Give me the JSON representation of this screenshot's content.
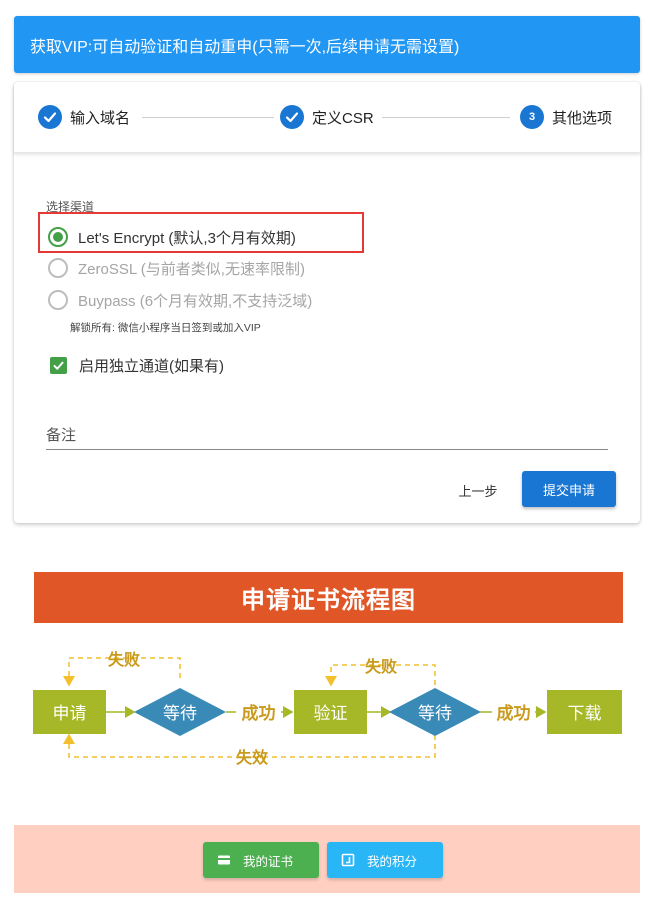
{
  "banner": {
    "text": "获取VIP:可自动验证和自动重申(只需一次,后续申请无需设置)"
  },
  "stepper": {
    "steps": [
      {
        "label": "输入域名",
        "state": "done"
      },
      {
        "label": "定义CSR",
        "state": "done"
      },
      {
        "label": "其他选项",
        "number": "3",
        "state": "active"
      }
    ]
  },
  "form": {
    "channel_label": "选择渠道",
    "channels": [
      {
        "label": "Let's Encrypt (默认,3个月有效期)",
        "selected": true
      },
      {
        "label": "ZeroSSL (与前者类似,无速率限制)",
        "selected": false
      },
      {
        "label": "Buypass (6个月有效期,不支持泛域)",
        "selected": false
      }
    ],
    "unlock_hint": "解锁所有: 微信小程序当日签到或加入VIP",
    "dedicated_channel_label": "启用独立通道(如果有)",
    "dedicated_channel_checked": true,
    "remark_placeholder": "备注",
    "prev_button": "上一步",
    "submit_button": "提交申请"
  },
  "flowchart": {
    "title": "申请证书流程图",
    "nodes": {
      "apply": "申请",
      "wait1": "等待",
      "verify": "验证",
      "wait2": "等待",
      "download": "下载"
    },
    "edges": {
      "success1": "成功",
      "success2": "成功",
      "fail1": "失败",
      "fail2": "失败",
      "expired": "失效"
    },
    "colors": {
      "title_bg": "#e05627",
      "box": "#a6b827",
      "diamond": "#3a8ab8",
      "dashed": "#f2c02c",
      "edge_text": "#c99a1c"
    }
  },
  "footer": {
    "my_certs": "我的证书",
    "my_points": "我的积分",
    "icons": [
      "card-icon",
      "calendar-icon"
    ]
  },
  "colors": {
    "primary": "#1976d2",
    "banner": "#2196f3",
    "success": "#43a047",
    "highlight": "#e53935",
    "footer_bg": "#ffd0c2"
  }
}
